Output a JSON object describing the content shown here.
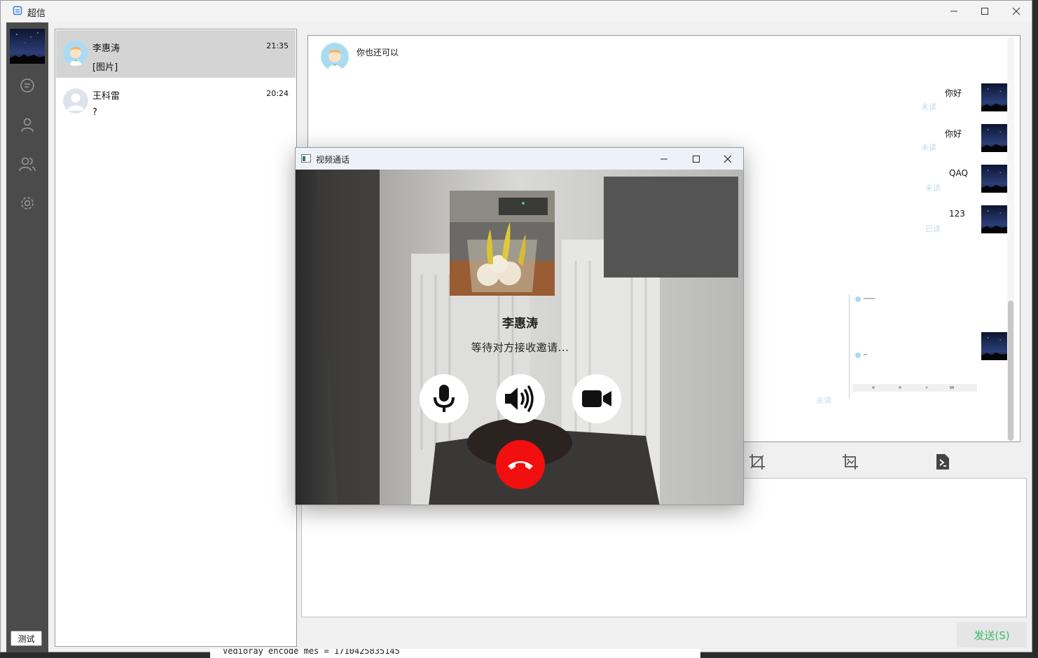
{
  "window": {
    "title": "超信"
  },
  "sidebar": {
    "test_button": "测试",
    "icons": [
      "chat-icon",
      "user-icon",
      "group-icon",
      "settings-icon"
    ]
  },
  "contacts": [
    {
      "name": "李惠涛",
      "time": "21:35",
      "preview": "[图片]",
      "active": true
    },
    {
      "name": "王科雷",
      "time": "20:24",
      "preview": "?",
      "active": false
    }
  ],
  "chat": {
    "incoming": [
      {
        "text": "你也还可以"
      }
    ],
    "outgoing": [
      {
        "text": "你好",
        "status": "未读"
      },
      {
        "text": "你好",
        "status": "未读"
      },
      {
        "text": "QAQ",
        "status": "未读"
      },
      {
        "text": "123",
        "status": "已读"
      },
      {
        "text": "",
        "status": "未读"
      }
    ]
  },
  "composer": {
    "send_label": "发送(S)"
  },
  "video_call": {
    "title": "视频通话",
    "caller_name": "李惠涛",
    "status": "等待对方接收邀请..."
  },
  "background_console": "Vedioray encode mes = 1710425835145",
  "colors": {
    "accent_green": "#3bbc6a",
    "hangup_red": "#f20f0f",
    "status_blue": "#c2dcee",
    "sidebar": "#4b4b4b"
  }
}
